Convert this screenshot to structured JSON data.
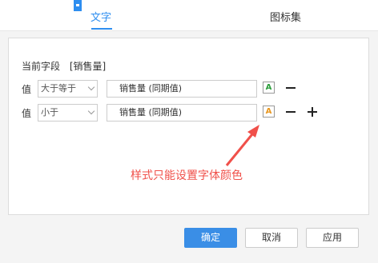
{
  "tabs": [
    {
      "label": "文字",
      "active": true
    },
    {
      "label": "图标集",
      "active": false
    }
  ],
  "panel": {
    "field_label": "当前字段",
    "field_value": "[销售量]",
    "rows": [
      {
        "label": "值",
        "condition": "大于等于",
        "value": "销售量 (同期值)",
        "style_glyph": "A",
        "style_color": "#2a9d3a"
      },
      {
        "label": "值",
        "condition": "小于",
        "value": "销售量 (同期值)",
        "style_glyph": "A",
        "style_color": "#e8961e"
      }
    ]
  },
  "annotation": "样式只能设置字体颜色",
  "buttons": {
    "ok": "确定",
    "cancel": "取消",
    "apply": "应用"
  },
  "colors": {
    "accent": "#2e8ef0",
    "annotation": "#f0504a"
  }
}
